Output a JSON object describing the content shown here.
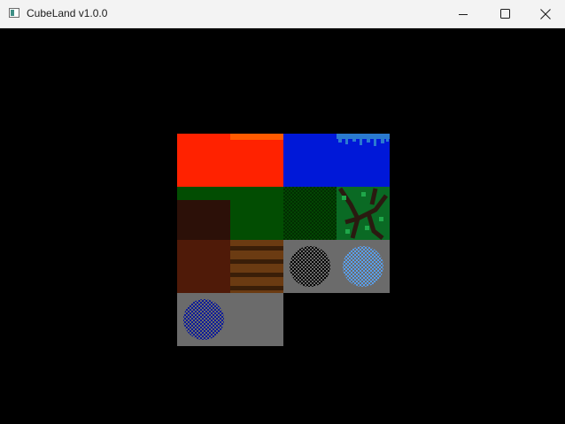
{
  "window": {
    "title": "CubeLand v1.0.0",
    "icons": {
      "app": "app-window-icon",
      "minimize": "minimize-icon",
      "maximize": "maximize-icon",
      "close": "close-icon"
    }
  },
  "texture_atlas": {
    "tiles": [
      {
        "name": "lava",
        "colors": [
          "#ff2200",
          "#ff5500"
        ]
      },
      {
        "name": "water",
        "colors": [
          "#0018d8",
          "#2288dd"
        ]
      },
      {
        "name": "grass-top",
        "colors": [
          "#024a02",
          "#033a03"
        ]
      },
      {
        "name": "leaves",
        "colors": [
          "#0a7a2a",
          "#2a1a10"
        ]
      },
      {
        "name": "dirt",
        "colors": [
          "#2c1008"
        ]
      },
      {
        "name": "grass-side",
        "colors": [
          "#024a02",
          "#2c1008"
        ]
      },
      {
        "name": "clay",
        "colors": [
          "#4f1a08"
        ]
      },
      {
        "name": "wood-planks",
        "colors": [
          "#6e3d10",
          "#3a1e08"
        ]
      },
      {
        "name": "coal-ore",
        "colors": [
          "#6b6b6b",
          "#000000"
        ]
      },
      {
        "name": "diamond-ore",
        "colors": [
          "#6b6b6b",
          "#4a90e0"
        ]
      },
      {
        "name": "lapis-ore",
        "colors": [
          "#6b6b6b",
          "#0a20a0"
        ]
      },
      {
        "name": "stone",
        "colors": [
          "#6b6b6b"
        ]
      }
    ]
  }
}
